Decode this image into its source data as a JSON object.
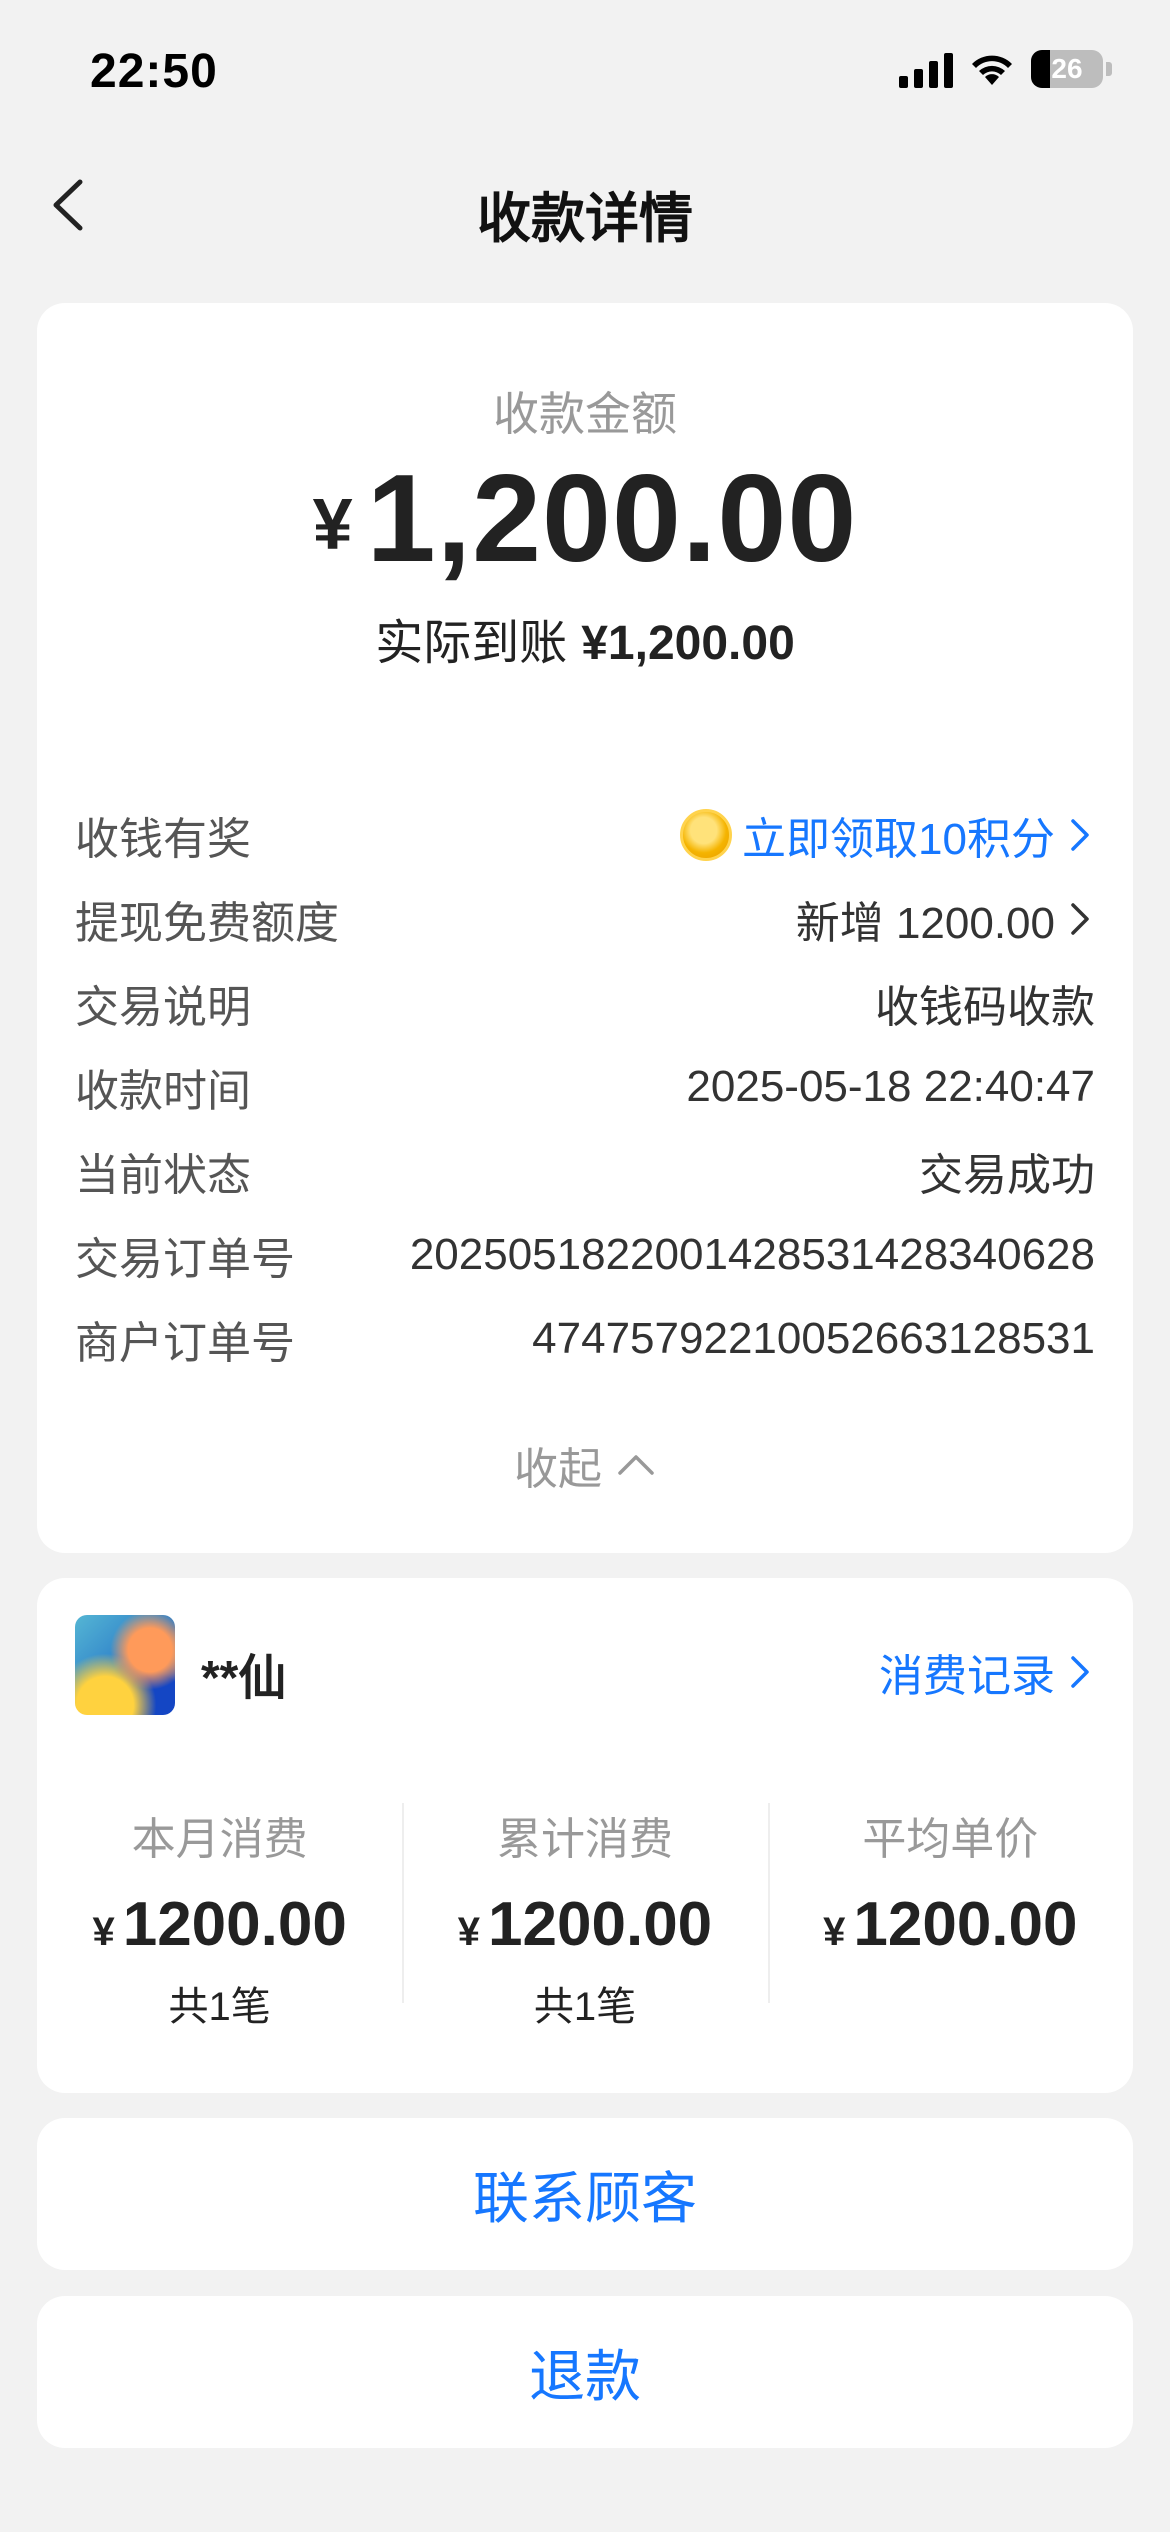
{
  "status": {
    "time": "22:50",
    "battery": "26",
    "battery_level": 0.26
  },
  "nav": {
    "title": "收款详情"
  },
  "payment": {
    "label": "收款金额",
    "currency": "¥",
    "amount": "1,200.00",
    "actual_label": "实际到账",
    "actual_value": "¥1,200.00"
  },
  "details": [
    {
      "key": "收钱有奖",
      "value": "立即领取10积分",
      "link": true,
      "icon": "coin-icon",
      "chevron": true
    },
    {
      "key": "提现免费额度",
      "value": "新增 1200.00",
      "link": false,
      "chevron": true
    },
    {
      "key": "交易说明",
      "value": "收钱码收款"
    },
    {
      "key": "收款时间",
      "value": "2025-05-18 22:40:47"
    },
    {
      "key": "当前状态",
      "value": "交易成功"
    },
    {
      "key": "交易订单号",
      "value": "2025051822001428531428340628"
    },
    {
      "key": "商户订单号",
      "value": "4747579221005266312853​1"
    }
  ],
  "collapse_label": "收起",
  "customer": {
    "name": "**仙",
    "records_label": "消费记录",
    "stats": [
      {
        "label": "本月消费",
        "currency": "¥",
        "value": "1200.00",
        "count": "共1笔"
      },
      {
        "label": "累计消费",
        "currency": "¥",
        "value": "1200.00",
        "count": "共1笔"
      },
      {
        "label": "平均单价",
        "currency": "¥",
        "value": "1200.00",
        "count": ""
      }
    ]
  },
  "actions": {
    "contact": "联系顾客",
    "refund": "退款"
  },
  "colors": {
    "accent": "#1677ff",
    "background": "#f2f2f2"
  }
}
